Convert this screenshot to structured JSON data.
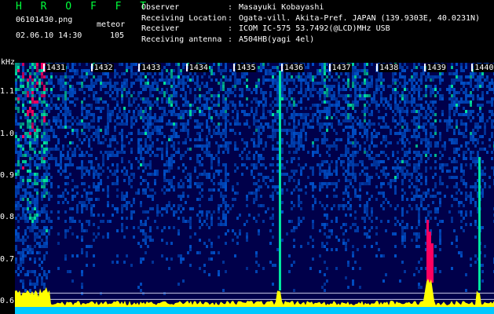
{
  "header": {
    "logo": "H R O F F T",
    "filename": "06101430.png",
    "datetime": "02.06.10 14:30",
    "mode": "meteor",
    "count": "105",
    "meta": [
      {
        "label": "Observer",
        "sep": ":",
        "value": "Masayuki Kobayashi"
      },
      {
        "label": "Receiving Location",
        "sep": ":",
        "value": "Ogata-vill. Akita-Pref. JAPAN (139.9303E, 40.0231N)"
      },
      {
        "label": "Receiver",
        "sep": ":",
        "value": "ICOM IC-575 53.7492(@LCD)MHz USB"
      },
      {
        "label": "Receiving antenna",
        "sep": ":",
        "value": "A504HB(yagi 4el)"
      }
    ]
  },
  "chart_data": {
    "type": "heatmap",
    "title": "",
    "ylabel": "kHz",
    "xlabel": "",
    "x_ticks": [
      "1431",
      "1432",
      "1433",
      "1434",
      "1435",
      "1436",
      "1437",
      "1438",
      "1439",
      "1440"
    ],
    "y_ticks": [
      "1.1",
      "1.0",
      "0.9",
      "0.8",
      "0.7",
      "0.6"
    ],
    "ylim": [
      0.57,
      1.17
    ],
    "colors": {
      "background": "#000000",
      "low": "#00004a",
      "mid": "#0050c8",
      "high": "#00e6a0",
      "peak": "#ff0060",
      "trace": "#ffff00",
      "baseline": "#00c8ff"
    }
  }
}
